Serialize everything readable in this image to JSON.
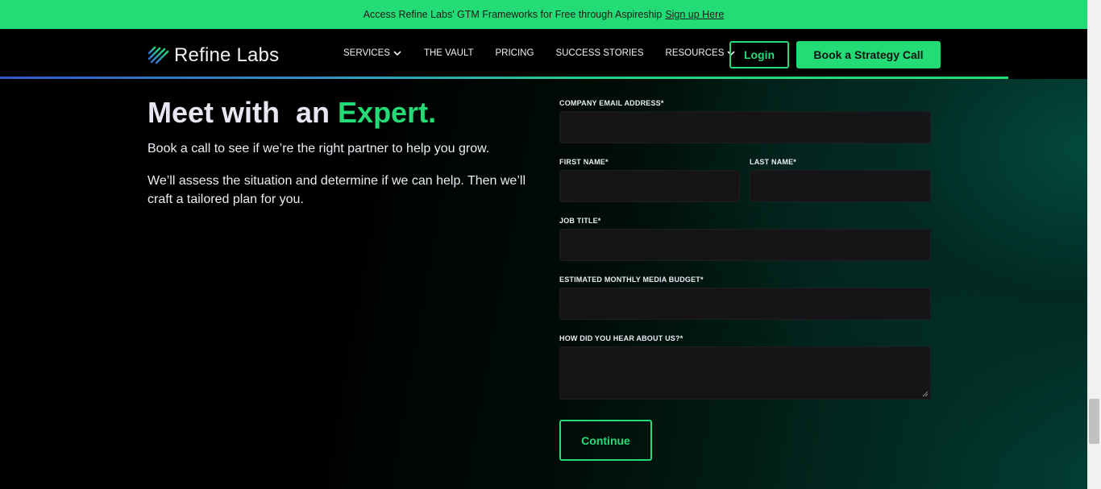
{
  "banner": {
    "text": "Access Refine Labs' GTM Frameworks for Free through Aspireship",
    "link": "Sign up Here"
  },
  "header": {
    "logo_text": "Refine Labs",
    "nav": [
      {
        "label": "SERVICES",
        "dropdown": true
      },
      {
        "label": "THE VAULT",
        "dropdown": false
      },
      {
        "label": "PRICING",
        "dropdown": false
      },
      {
        "label": "SUCCESS STORIES",
        "dropdown": false
      },
      {
        "label": "RESOURCES",
        "dropdown": true
      }
    ],
    "login_label": "Login",
    "cta_label": "Book a Strategy Call"
  },
  "hero": {
    "title_part1": "Meet with  an ",
    "title_accent": "Expert.",
    "paragraph1": "Book a call to see if we’re the right partner to help you grow.",
    "paragraph2": "We’ll assess the situation and determine if we can help. Then we’ll craft a tailored plan for you."
  },
  "form": {
    "company_email_label": "COMPANY EMAIL ADDRESS*",
    "company_email_value": "",
    "first_name_label": "FIRST NAME*",
    "first_name_value": "",
    "last_name_label": "LAST NAME*",
    "last_name_value": "",
    "job_title_label": "JOB TITLE*",
    "job_title_value": "",
    "budget_label": "ESTIMATED MONTHLY MEDIA BUDGET*",
    "budget_value": "",
    "hear_label": "HOW DID YOU HEAR ABOUT US?*",
    "hear_value": "",
    "continue_label": "Continue"
  },
  "colors": {
    "accent": "#24dc75",
    "background": "#000000",
    "input_bg": "#151517"
  }
}
